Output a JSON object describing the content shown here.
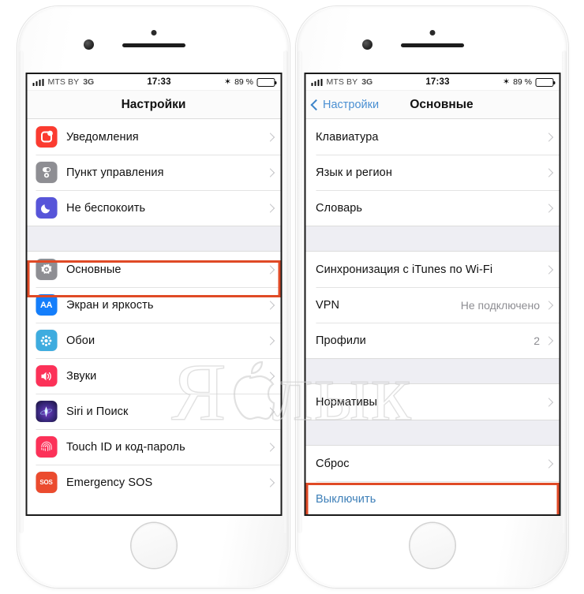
{
  "watermark": {
    "text_before": "Я",
    "text_after": "лык",
    "icon": "apple-logo-icon"
  },
  "status_bar": {
    "signal_icon": "signal-bars-icon",
    "carrier": "MTS BY",
    "network": "3G",
    "time": "17:33",
    "bluetooth_icon": "bluetooth-icon",
    "battery_percent": "89 %",
    "battery_icon": "battery-icon",
    "battery_level": 89
  },
  "left_phone": {
    "nav": {
      "title": "Настройки"
    },
    "sections": [
      {
        "rows": [
          {
            "label": "Уведомления",
            "icon": "notifications-icon",
            "color": "#FB3B30",
            "chevron": true
          },
          {
            "label": "Пункт управления",
            "icon": "control-center-icon",
            "color": "#8E8E93",
            "chevron": true
          },
          {
            "label": "Не беспокоить",
            "icon": "do-not-disturb-icon",
            "color": "#5755D9",
            "chevron": true
          }
        ]
      },
      {
        "rows": [
          {
            "label": "Основные",
            "icon": "general-gear-icon",
            "color": "#8E8E93",
            "chevron": true,
            "highlighted": true
          },
          {
            "label": "Экран и яркость",
            "icon": "display-brightness-icon",
            "color": "#147EFB",
            "chevron": true
          },
          {
            "label": "Обои",
            "icon": "wallpaper-icon",
            "color": "#3EACDF",
            "chevron": true
          },
          {
            "label": "Звуки",
            "icon": "sounds-icon",
            "color": "#FC3158",
            "chevron": true
          },
          {
            "label": "Siri и Поиск",
            "icon": "siri-icon",
            "color": "#2B2257",
            "chevron": true
          },
          {
            "label": "Touch ID и код-пароль",
            "icon": "touch-id-icon",
            "color": "#FC3158",
            "chevron": true
          },
          {
            "label": "Emergency SOS",
            "icon": "emergency-sos-icon",
            "color": "#EB4B2E",
            "chevron": true
          }
        ]
      }
    ]
  },
  "right_phone": {
    "nav": {
      "back_label": "Настройки",
      "back_icon": "chevron-left-icon",
      "title": "Основные"
    },
    "sections": [
      {
        "rows": [
          {
            "label": "Клавиатура",
            "chevron": true
          },
          {
            "label": "Язык и регион",
            "chevron": true
          },
          {
            "label": "Словарь",
            "chevron": true
          }
        ]
      },
      {
        "rows": [
          {
            "label": "Синхронизация с iTunes по Wi-Fi",
            "chevron": true
          },
          {
            "label": "VPN",
            "value": "Не подключено",
            "chevron": true
          },
          {
            "label": "Профили",
            "value": "2",
            "chevron": true
          }
        ]
      },
      {
        "rows": [
          {
            "label": "Нормативы",
            "chevron": true
          }
        ]
      },
      {
        "rows": [
          {
            "label": "Сброс",
            "chevron": true
          },
          {
            "label": "Выключить",
            "chevron": false,
            "blue": true,
            "highlighted": true
          }
        ]
      }
    ]
  },
  "colors": {
    "highlight_border": "#e04a26",
    "ios_blue": "#3d7fb8",
    "separator": "#e3e3e3",
    "group_background": "#eeeef3"
  }
}
